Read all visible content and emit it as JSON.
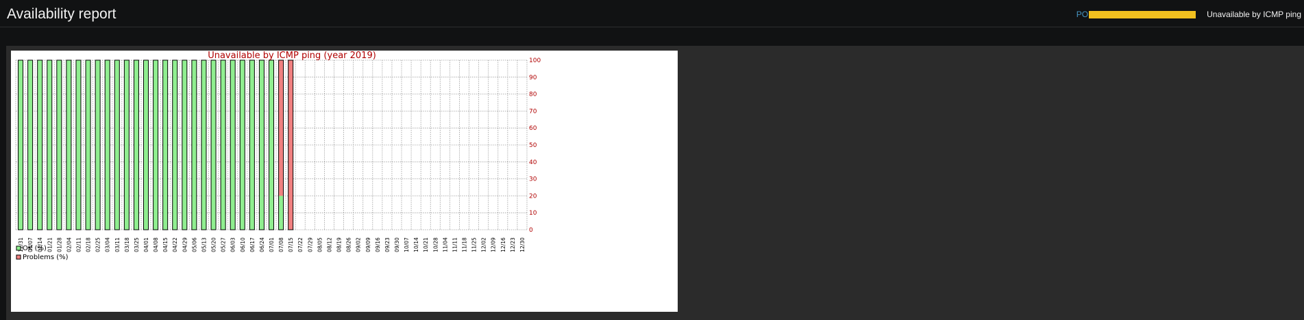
{
  "header": {
    "title": "Availability report",
    "host_label": "PO",
    "trigger_name": "Unavailable by ICMP ping"
  },
  "colors": {
    "background": "#111213",
    "panel": "#2b2b2b",
    "host_bar": "#f2c01f",
    "ok": "#90ee90",
    "problems": "#f08080",
    "chart_text": "#b00000"
  },
  "chart_data": {
    "type": "bar",
    "stacked": true,
    "title": "Unavailable by ICMP ping (year 2019)",
    "xlabel": "",
    "ylabel": "",
    "ylim": [
      0,
      100
    ],
    "y_axis_side": "right",
    "yticks": [
      "0",
      "10",
      "20",
      "30",
      "40",
      "50",
      "60",
      "70",
      "80",
      "90",
      "100"
    ],
    "grid": true,
    "legend_placement": "bottom-left",
    "categories": [
      "12/31",
      "01/07",
      "01/14",
      "01/21",
      "01/28",
      "02/04",
      "02/11",
      "02/18",
      "02/25",
      "03/04",
      "03/11",
      "03/18",
      "03/25",
      "04/01",
      "04/08",
      "04/15",
      "04/22",
      "04/29",
      "05/06",
      "05/13",
      "05/20",
      "05/27",
      "06/03",
      "06/10",
      "06/17",
      "06/24",
      "07/01",
      "07/08",
      "07/15",
      "07/22",
      "07/29",
      "08/05",
      "08/12",
      "08/19",
      "08/26",
      "09/02",
      "09/09",
      "09/16",
      "09/23",
      "09/30",
      "10/07",
      "10/14",
      "10/21",
      "10/28",
      "11/04",
      "11/11",
      "11/18",
      "11/25",
      "12/02",
      "12/09",
      "12/16",
      "12/23",
      "12/30"
    ],
    "series": [
      {
        "name": "OK (%)",
        "color": "#90ee90",
        "values": [
          100,
          100,
          100,
          100,
          100,
          100,
          100,
          100,
          100,
          100,
          100,
          100,
          100,
          100,
          100,
          100,
          100,
          100,
          100,
          100,
          100,
          100,
          100,
          100,
          100,
          100,
          100,
          20,
          0,
          null,
          null,
          null,
          null,
          null,
          null,
          null,
          null,
          null,
          null,
          null,
          null,
          null,
          null,
          null,
          null,
          null,
          null,
          null,
          null,
          null,
          null,
          null,
          null
        ]
      },
      {
        "name": "Problems (%)",
        "color": "#f08080",
        "values": [
          0,
          0,
          0,
          0,
          0,
          0,
          0,
          0,
          0,
          0,
          0,
          0,
          0,
          0,
          0,
          0,
          0,
          0,
          0,
          0,
          0,
          0,
          0,
          0,
          0,
          0,
          0,
          80,
          100,
          null,
          null,
          null,
          null,
          null,
          null,
          null,
          null,
          null,
          null,
          null,
          null,
          null,
          null,
          null,
          null,
          null,
          null,
          null,
          null,
          null,
          null,
          null,
          null
        ]
      }
    ]
  }
}
